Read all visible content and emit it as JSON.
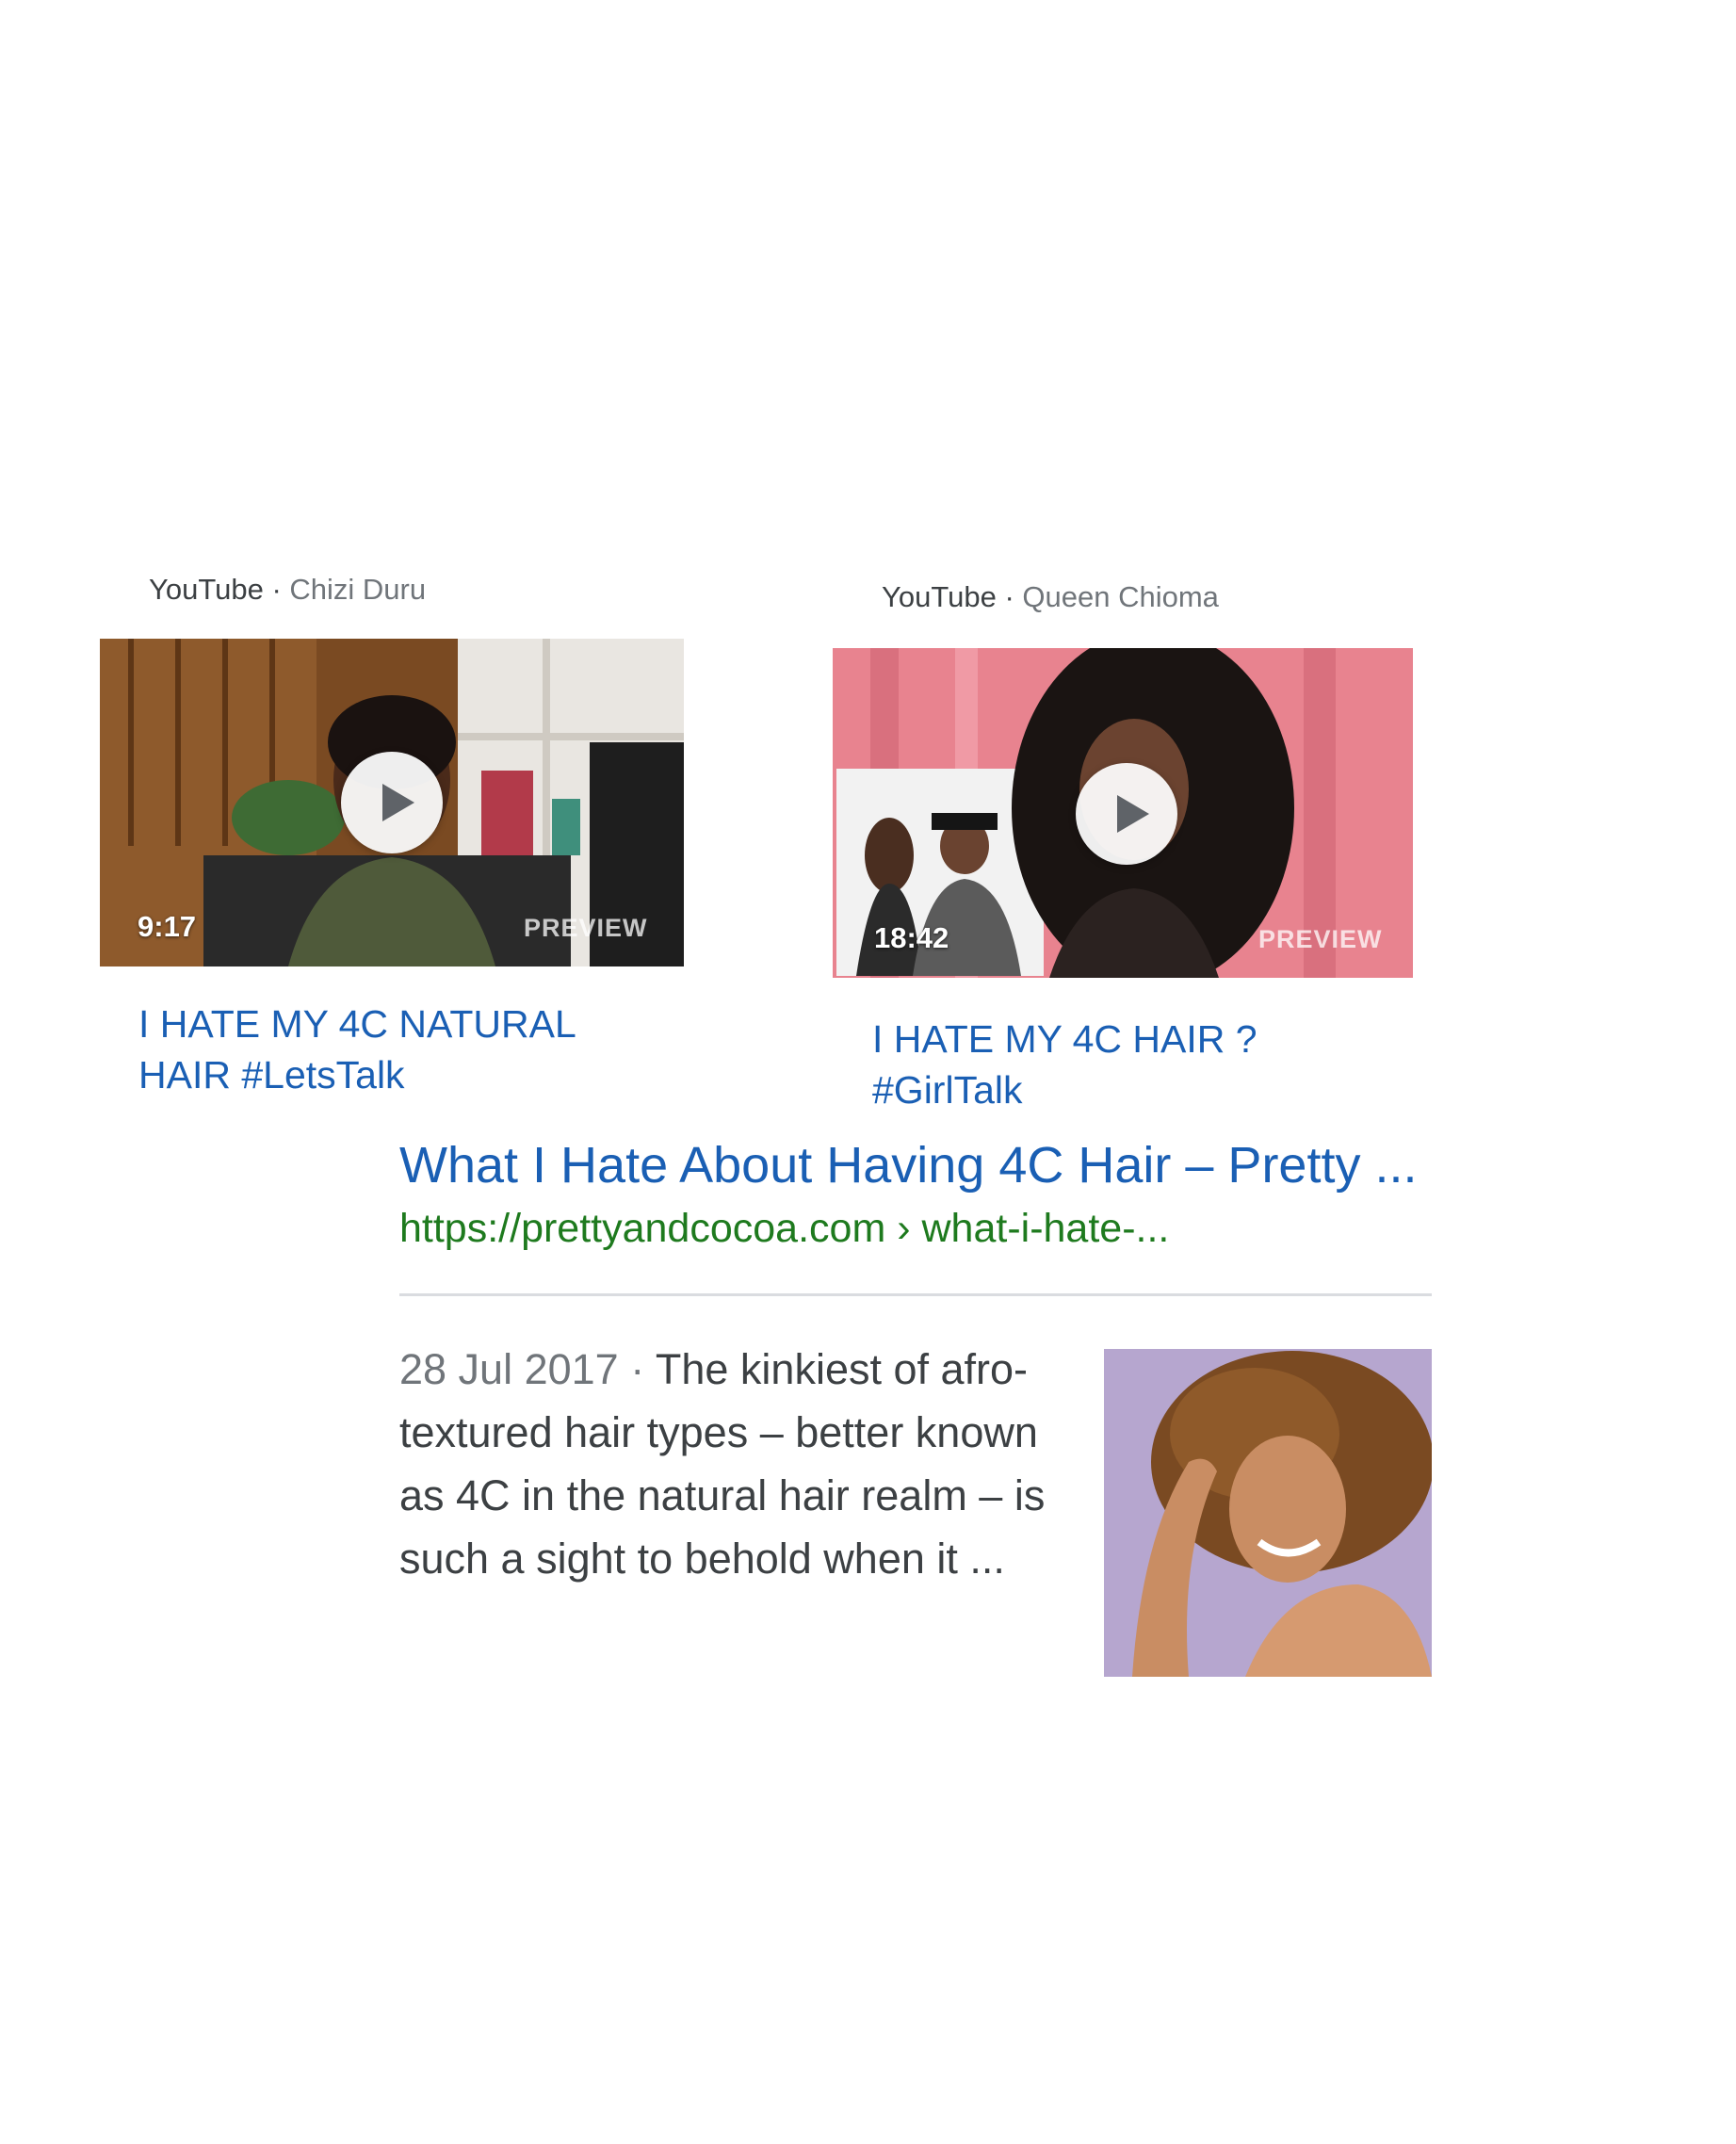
{
  "videos": [
    {
      "source": "YouTube",
      "separator": " · ",
      "channel": "Chizi Duru",
      "duration": "9:17",
      "preview_label": "PREVIEW",
      "title": "I HATE MY 4C NATURAL HAIR #LetsTalk"
    },
    {
      "source": "YouTube",
      "separator": " · ",
      "channel": "Queen Chioma",
      "duration": "18:42",
      "preview_label": "PREVIEW",
      "title": "I HATE MY 4C HAIR ? #GirlTalk"
    }
  ],
  "web_result": {
    "title": "What I Hate About Having 4C Hair – Pretty ...",
    "url": "https://prettyandcocoa.com › what-i-hate-...",
    "date": "28 Jul 2017",
    "separator": " · ",
    "snippet": "The kinkiest of afro-textured hair types – better known as 4C in the natural hair realm – is such a sight to behold when it ..."
  },
  "colors": {
    "link_blue": "#1a5fb4",
    "url_green": "#1e7a1e",
    "snippet_text": "#3c4043",
    "meta_gray": "#70757a"
  }
}
